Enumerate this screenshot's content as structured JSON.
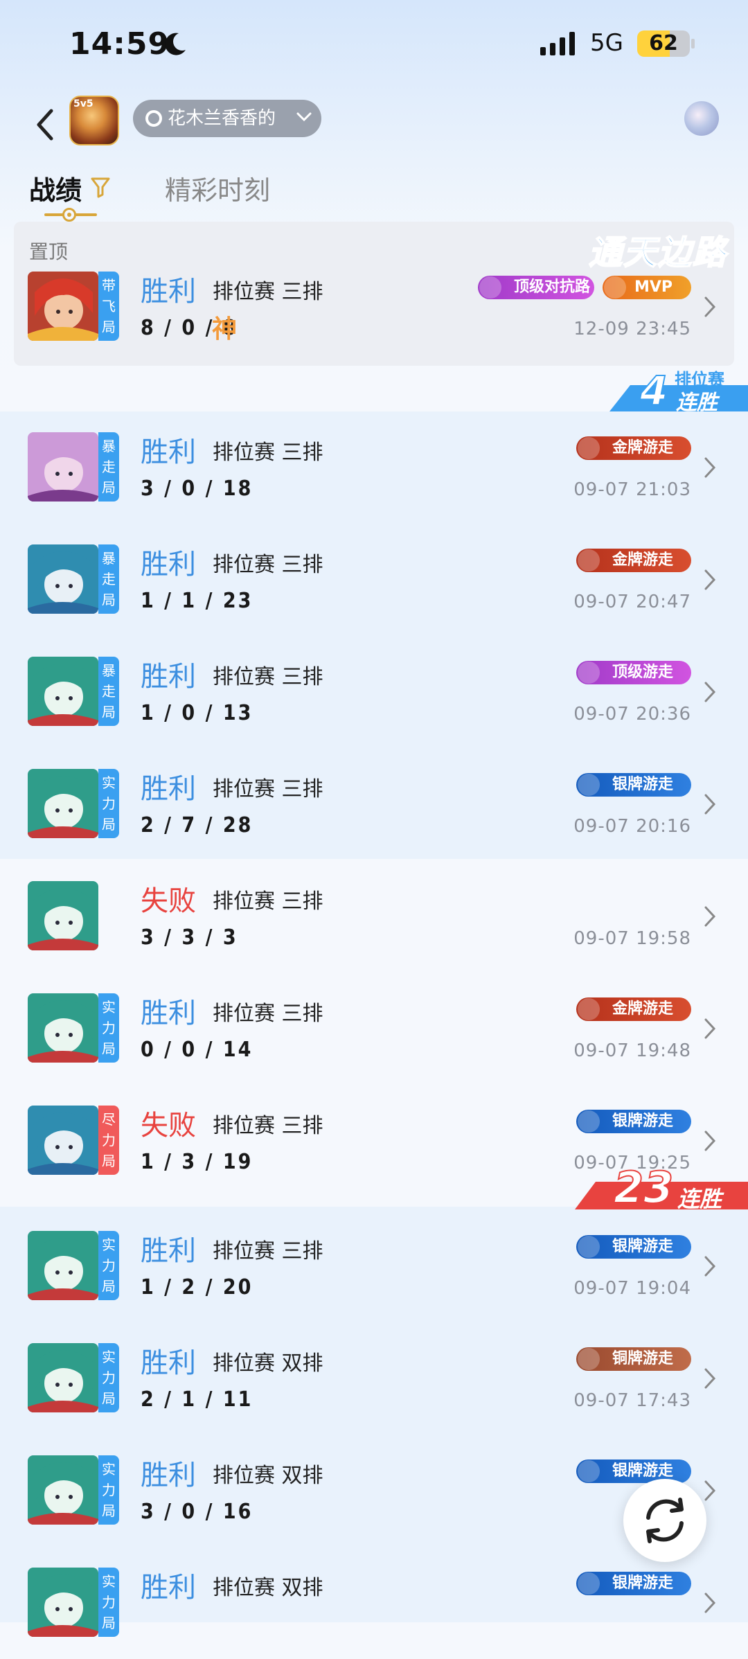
{
  "status_bar": {
    "time": "14:59",
    "network": "5G",
    "battery": "62"
  },
  "header": {
    "account_name": "花木兰香香的"
  },
  "tabs": [
    {
      "label": "战绩"
    },
    {
      "label": "精彩时刻"
    }
  ],
  "pinned": {
    "label": "置顶",
    "banner": "通天边路",
    "match": {
      "tag": "带飞局",
      "tag_color": "#3aa0f0",
      "result": "胜利",
      "mode": "排位赛  三排",
      "kda": "8 / 0 / 8",
      "god": "神",
      "badge1": "顶级对抗路",
      "badge2": "MVP",
      "date": "12-09 23:45"
    }
  },
  "streaks": [
    {
      "top": "排位赛",
      "count": "4",
      "word": "连胜"
    },
    {
      "count": "23",
      "word": "连胜"
    }
  ],
  "matches": [
    {
      "tag": "暴走局",
      "tag_color": "#3aa0f0",
      "result": "胜利",
      "outcome": "win",
      "mode": "排位赛  三排",
      "kda": "3 / 0 / 18",
      "badge": "金牌游走",
      "badge_type": "gold",
      "date": "09-07 21:03"
    },
    {
      "tag": "暴走局",
      "tag_color": "#3aa0f0",
      "result": "胜利",
      "outcome": "win",
      "mode": "排位赛  三排",
      "kda": "1 / 1 / 23",
      "badge": "金牌游走",
      "badge_type": "gold",
      "date": "09-07 20:47"
    },
    {
      "tag": "暴走局",
      "tag_color": "#3aa0f0",
      "result": "胜利",
      "outcome": "win",
      "mode": "排位赛  三排",
      "kda": "1 / 0 / 13",
      "badge": "顶级游走",
      "badge_type": "top",
      "date": "09-07 20:36"
    },
    {
      "tag": "实力局",
      "tag_color": "#3aa0f0",
      "result": "胜利",
      "outcome": "win",
      "mode": "排位赛  三排",
      "kda": "2 / 7 / 28",
      "badge": "银牌游走",
      "badge_type": "silver",
      "date": "09-07 20:16"
    },
    {
      "tag": "",
      "tag_color": "",
      "result": "失败",
      "outcome": "lose",
      "mode": "排位赛  三排",
      "kda": "3 / 3 / 3",
      "badge": "",
      "badge_type": "",
      "date": "09-07 19:58"
    },
    {
      "tag": "实力局",
      "tag_color": "#3aa0f0",
      "result": "胜利",
      "outcome": "win",
      "mode": "排位赛  三排",
      "kda": "0 / 0 / 14",
      "badge": "金牌游走",
      "badge_type": "gold",
      "date": "09-07 19:48"
    },
    {
      "tag": "尽力局",
      "tag_color": "#f05a5a",
      "result": "失败",
      "outcome": "lose",
      "mode": "排位赛  三排",
      "kda": "1 / 3 / 19",
      "badge": "银牌游走",
      "badge_type": "silver",
      "date": "09-07 19:25"
    },
    {
      "tag": "实力局",
      "tag_color": "#3aa0f0",
      "result": "胜利",
      "outcome": "win",
      "mode": "排位赛  三排",
      "kda": "1 / 2 / 20",
      "badge": "银牌游走",
      "badge_type": "silver",
      "date": "09-07 19:04"
    },
    {
      "tag": "实力局",
      "tag_color": "#3aa0f0",
      "result": "胜利",
      "outcome": "win",
      "mode": "排位赛  双排",
      "kda": "2 / 1 / 11",
      "badge": "铜牌游走",
      "badge_type": "bronze",
      "date": "09-07 17:43"
    },
    {
      "tag": "实力局",
      "tag_color": "#3aa0f0",
      "result": "胜利",
      "outcome": "win",
      "mode": "排位赛  双排",
      "kda": "3 / 0 / 16",
      "badge": "银牌游走",
      "badge_type": "silver",
      "date": "09-0"
    },
    {
      "tag": "实力局",
      "tag_color": "#3aa0f0",
      "result": "胜利",
      "outcome": "win",
      "mode": "排位赛  双排",
      "kda": "",
      "badge": "银牌游走",
      "badge_type": "silver",
      "date": ""
    }
  ]
}
